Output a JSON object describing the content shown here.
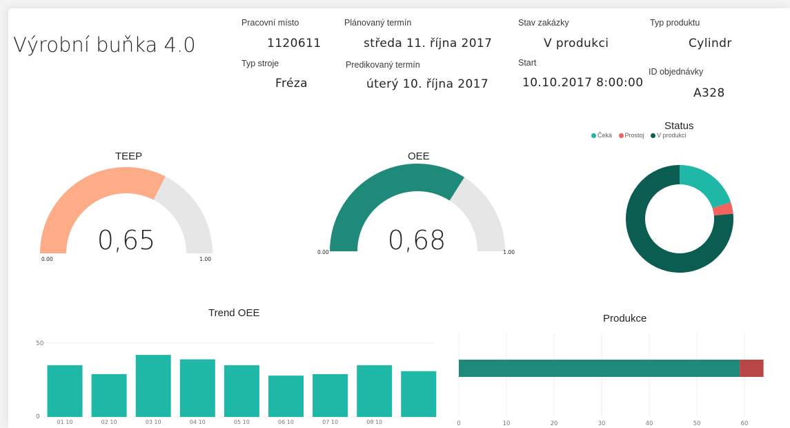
{
  "report": {
    "title": "Výrobní buňka 4.0"
  },
  "cards": {
    "workplace": {
      "label": "Pracovní místo",
      "value": "1120611"
    },
    "machine_type": {
      "label": "Typ stroje",
      "value": "Fréza"
    },
    "planned_date": {
      "label": "Plánovaný termín",
      "value": "středa 11. října 2017"
    },
    "predicted_date": {
      "label": "Predikovaný termín",
      "value": "úterý 10. října 2017"
    },
    "order_status": {
      "label": "Stav zakázky",
      "value": "V produkci"
    },
    "start": {
      "label": "Start",
      "value": "10.10.2017 8:00:00"
    },
    "product_type": {
      "label": "Typ produktu",
      "value": "Cylindr"
    },
    "order_id": {
      "label": "ID objednávky",
      "value": "A328"
    }
  },
  "colors": {
    "teep": "#fdac87",
    "oee": "#1f8a7a",
    "gauge_track": "#e6e6e6",
    "teal": "#1fb8a6",
    "dark_teal": "#0b5c51",
    "red": "#f2635e",
    "dark_red": "#b94646"
  },
  "chart_data": [
    {
      "type": "gauge",
      "title": "TEEP",
      "value": 0.65,
      "value_label": "0,65",
      "min_label": "0.00",
      "max_label": "1.00",
      "range": [
        0,
        1
      ]
    },
    {
      "type": "gauge",
      "title": "OEE",
      "value": 0.68,
      "value_label": "0,68",
      "min_label": "0.00",
      "max_label": "1.00",
      "range": [
        0,
        1
      ]
    },
    {
      "type": "pie",
      "title": "Status",
      "legend_position": "top",
      "series": [
        {
          "name": "Čeká",
          "value": 0.2,
          "color": "#1fb8a6"
        },
        {
          "name": "Prostoj",
          "value": 0.035,
          "color": "#f2635e"
        },
        {
          "name": "V produkci",
          "value": 0.765,
          "color": "#0b5c51"
        }
      ]
    },
    {
      "type": "bar",
      "title": "Trend OEE",
      "categories": [
        "01 10",
        "02 10",
        "03 10",
        "04 10",
        "05 10",
        "06 10",
        "07 10",
        "08 10",
        ""
      ],
      "values": [
        35,
        29,
        42,
        39,
        35,
        28,
        29,
        35,
        31
      ],
      "ylim": [
        0,
        50
      ],
      "yticks": [
        "0",
        "50"
      ],
      "grid": true
    },
    {
      "type": "bar",
      "orientation": "horizontal",
      "stacked": true,
      "title": "Produkce",
      "series": [
        {
          "values": [
            59
          ],
          "color": "#1f8a7a"
        },
        {
          "values": [
            5
          ],
          "color": "#b94646"
        }
      ],
      "xlim": [
        0,
        65
      ],
      "xticks": [
        "0",
        "10",
        "20",
        "30",
        "40",
        "50",
        "60"
      ],
      "grid": true
    }
  ]
}
